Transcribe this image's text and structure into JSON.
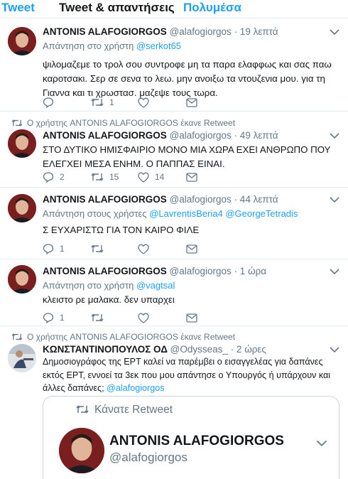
{
  "tabs": [
    "Tweet",
    "Tweet & απαντήσεις",
    "Πολυμέσα"
  ],
  "tweets": [
    {
      "name": "ANTONIS ALAFOGIORGOS",
      "handle": "@alafogiorgos",
      "time": "· 19 λεπτά",
      "reply_prefix": "Απάντηση στο χρήστη ",
      "reply_mentions": [
        "@serkot65"
      ],
      "text": "ψιλομαζεμε το τρολ σου συντροφε μη τα παρα ελαφφως και σας παω καροτσακι. Σερ σε σενα το λεω. μην ανοιξω τα ντουζενια μου. για τη Γιαννα και τι χρωστασ. μαζεψε τους τωρα.",
      "replies": "",
      "retweets": "1",
      "likes": ""
    },
    {
      "retweet_note": "Ο χρήστης ANTONIS ALAFOGIORGOS έκανε Retweet",
      "name": "ANTONIS ALAFOGIORGOS",
      "handle": "@alafogiorgos",
      "time": "· 49 λεπτά",
      "text": "ΣΤΟ ΔΥΤΙΚΟ ΗΜΙΣΦΑΙΡΙΟ ΜΟΝΟ ΜΙΑ ΧΩΡΑ ΕΧΕΙ ΑΝΘΡΩΠΟ ΠΟΥ ΕΛΕΓΧΕΙ ΜΕΣΑ ΕΝΗΜ. Ο ΠΑΠΠΑΣ ΕΙΝΑΙ.",
      "replies": "2",
      "retweets": "15",
      "likes": "14"
    },
    {
      "name": "ANTONIS ALAFOGIORGOS",
      "handle": "@alafogiorgos",
      "time": "· 44 λεπτά",
      "reply_prefix": "Απάντηση στους χρήστες ",
      "reply_mentions": [
        "@LavrentisBeria4",
        "@GeorgeTetradis"
      ],
      "text": "Σ ΕΥΧΑΡΙΣΤΩ ΓΙΑ ΤΟΝ ΚΑΙΡΟ ΦΙΛΕ",
      "replies": "1",
      "retweets": "",
      "likes": ""
    },
    {
      "name": "ANTONIS ALAFOGIORGOS",
      "handle": "@alafogiorgos",
      "time": "· 1 ώρα",
      "reply_prefix": "Απάντηση στο χρήστη ",
      "reply_mentions": [
        "@vagtsal"
      ],
      "text": "κλειστο ρε μαλακα. δεν υπαρχει",
      "replies": "1",
      "retweets": "",
      "likes": ""
    },
    {
      "retweet_note": "Ο χρήστης ANTONIS ALAFOGIORGOS έκανε Retweet",
      "name": "ΚΩΝΣΤΑΝΤΙΝΟΠΟΥΛΟΣ ΟΔ",
      "handle": "@Odysseas_",
      "time": "· 2 ώρες",
      "text": "Δημοσιογράφος της ΕΡΤ καλεί να παρέμβει ο εισαγγελέας για δαπάνες εκτός ΕΡΤ, εννοεί τα 3εκ που μου απάντησε ο Υπουργός ή υπάρχουν και άλλες δαπάνες; ",
      "text_mention": "@alafogiorgos",
      "quote": {
        "retweet_label": "Κάνατε Retweet",
        "name": "ANTONIS ALAFOGIORGOS",
        "handle": "@alafogiorgos"
      }
    }
  ]
}
